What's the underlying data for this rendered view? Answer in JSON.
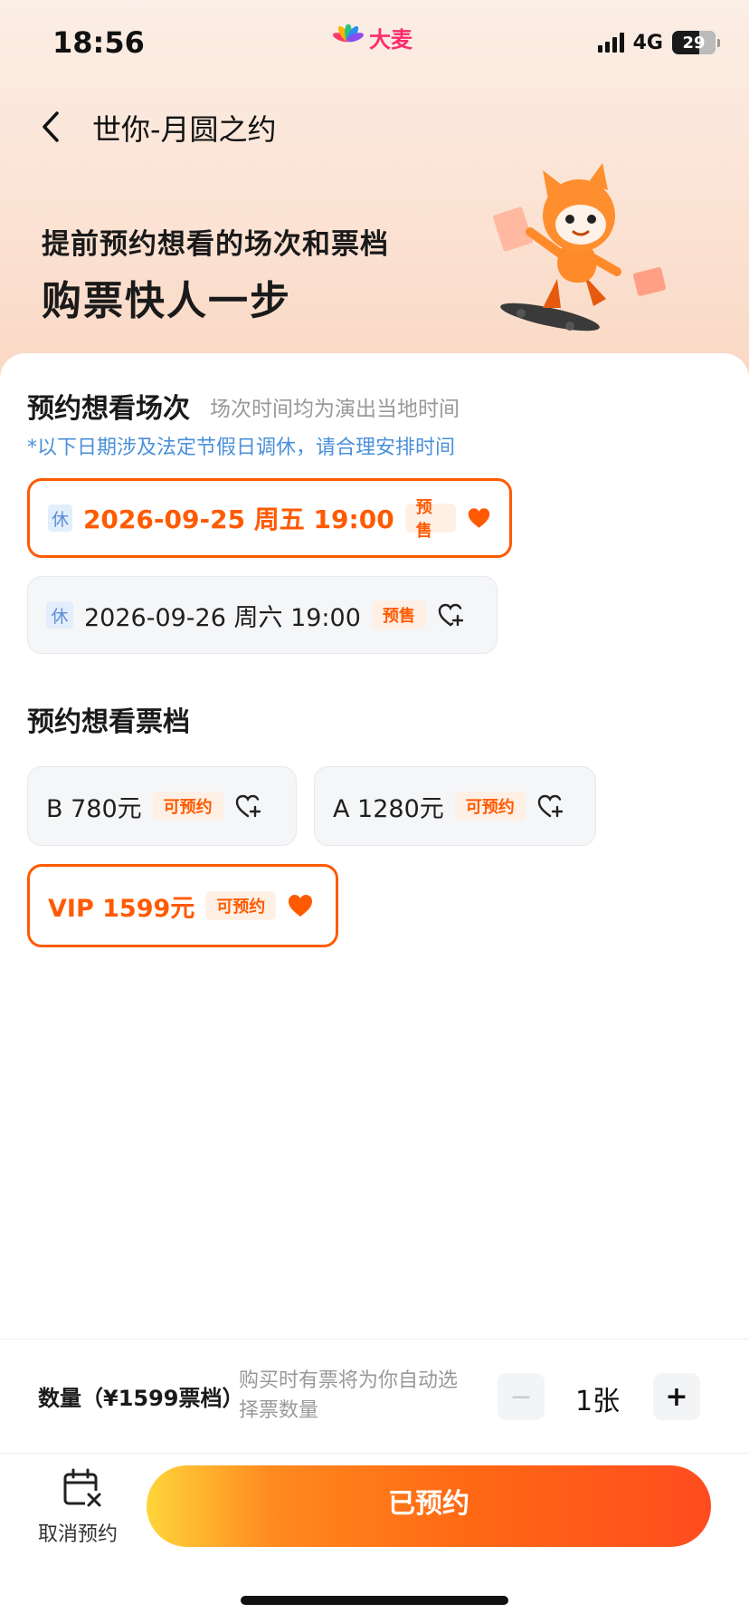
{
  "status_bar": {
    "time": "18:56",
    "network": "4G",
    "battery": "29",
    "brand_text": "大麦"
  },
  "nav": {
    "title": "世你-月圆之约"
  },
  "hero": {
    "line1": "提前预约想看的场次和票档",
    "line2": "购票快人一步"
  },
  "sessions": {
    "title": "预约想看场次",
    "subtitle": "场次时间均为演出当地时间",
    "notice": "*以下日期涉及法定节假日调休，请合理安排时间",
    "items": [
      {
        "rest": "休",
        "label": "2026-09-25  周五 19:00",
        "tag": "预售",
        "selected": true
      },
      {
        "rest": "休",
        "label": "2026-09-26 周六 19:00",
        "tag": "预售",
        "selected": false
      }
    ]
  },
  "tiers": {
    "title": "预约想看票档",
    "items": [
      {
        "label": "B 780元",
        "tag": "可预约",
        "selected": false
      },
      {
        "label": "A 1280元",
        "tag": "可预约",
        "selected": false
      },
      {
        "label": "VIP 1599元",
        "tag": "可预约",
        "selected": true
      }
    ]
  },
  "quantity": {
    "label": "数量（¥1599票档）",
    "hint": "购买时有票将为你自动选择票数量",
    "minus": "−",
    "plus": "+",
    "value": "1张"
  },
  "actions": {
    "cancel_label": "取消预约",
    "main_label": "已预约"
  },
  "colors": {
    "accent": "#ff5a00",
    "notice_blue": "#4a90d9"
  },
  "icons": {
    "back": "chevron-left-icon",
    "favorite_filled": "heart-filled-icon",
    "favorite_add": "heart-plus-icon",
    "cancel": "calendar-x-icon"
  }
}
